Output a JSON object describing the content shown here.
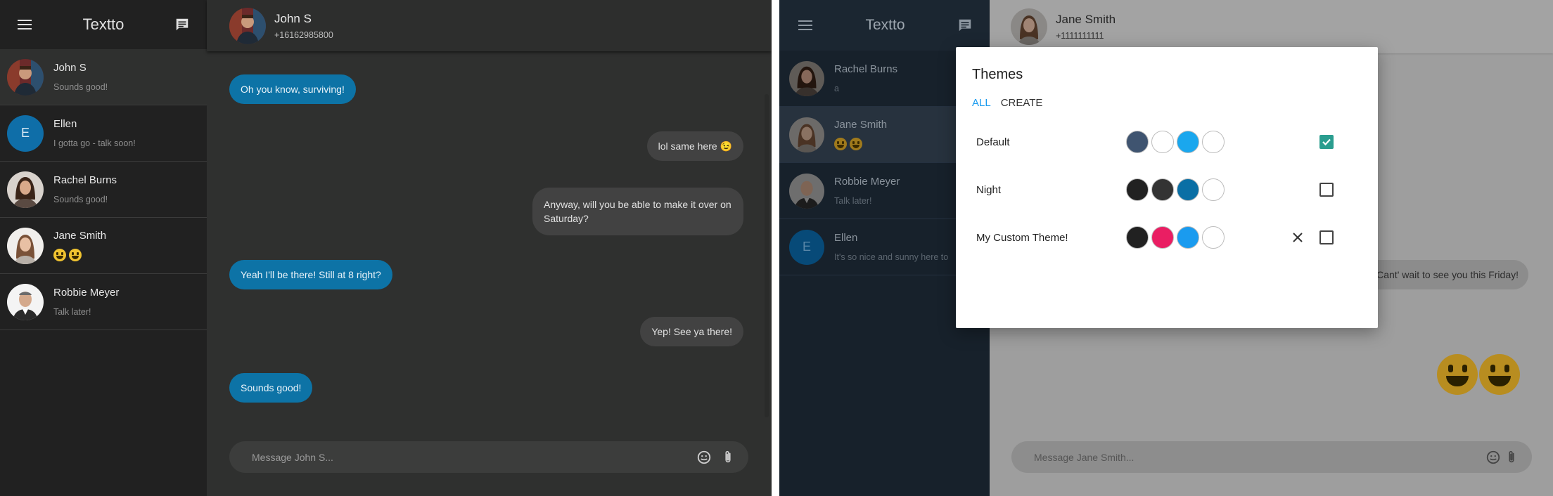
{
  "left": {
    "app_title": "Textto",
    "conversations": [
      {
        "name": "John S",
        "snippet": "Sounds good!"
      },
      {
        "name": "Ellen",
        "initial": "E",
        "snippet": "I gotta go - talk soon!"
      },
      {
        "name": "Rachel Burns",
        "snippet": "Sounds good!"
      },
      {
        "name": "Jane Smith",
        "snippet": "😀😀"
      },
      {
        "name": "Robbie Meyer",
        "snippet": "Talk later!"
      }
    ],
    "contact": {
      "name": "John S",
      "phone": "+16162985800"
    },
    "messages": [
      {
        "direction": "in",
        "text": "Oh you know, surviving!"
      },
      {
        "direction": "out",
        "text": "lol same here 😉"
      },
      {
        "direction": "out",
        "text": "Anyway, will you be able to make it over on Saturday?"
      },
      {
        "direction": "in",
        "text": "Yeah I'll be there! Still at 8 right?"
      },
      {
        "direction": "out",
        "text": "Yep! See ya there!"
      },
      {
        "direction": "in",
        "text": "Sounds good!"
      }
    ],
    "composer_placeholder": "Message John S..."
  },
  "right": {
    "app_title": "Textto",
    "conversations": [
      {
        "name": "Rachel Burns",
        "snippet": "a"
      },
      {
        "name": "Jane Smith",
        "snippet": "😀😀"
      },
      {
        "name": "Robbie Meyer",
        "snippet": "Talk later!"
      },
      {
        "name": "Ellen",
        "initial": "E",
        "snippet": "It's so nice and sunny here to"
      }
    ],
    "contact": {
      "name": "Jane Smith",
      "phone": "+1111111111"
    },
    "visible_message": "Cant' wait to see you this Friday!",
    "composer_placeholder": "Message Jane Smith...",
    "dialog": {
      "title": "Themes",
      "tabs": [
        "ALL",
        "CREATE"
      ],
      "active_tab": "ALL",
      "themes": [
        {
          "name": "Default",
          "colors": [
            "#3f5470",
            "#ffffff",
            "#1aa7ee",
            "#ffffff"
          ],
          "selected": true,
          "deletable": false
        },
        {
          "name": "Night",
          "colors": [
            "#212121",
            "#333333",
            "#0a6fa5",
            "#ffffff"
          ],
          "selected": false,
          "deletable": false
        },
        {
          "name": "My Custom Theme!",
          "colors": [
            "#212121",
            "#ea1e63",
            "#1a9bef",
            "#ffffff"
          ],
          "selected": false,
          "deletable": true
        }
      ]
    }
  },
  "colors": {
    "accent_blue": "#0d73a6",
    "checkbox_checked": "#2a9d8f"
  },
  "icons": [
    "menu-icon",
    "new-message-icon",
    "emoji-icon",
    "attachment-icon",
    "close-icon",
    "check-icon"
  ]
}
